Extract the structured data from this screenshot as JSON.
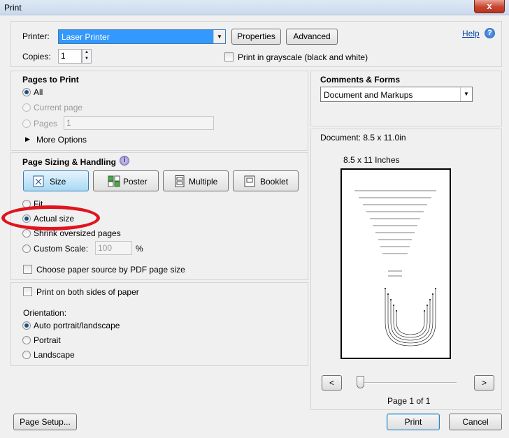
{
  "window": {
    "title": "Print",
    "close_glyph": "x"
  },
  "printer": {
    "label": "Printer:",
    "value": "Laser Printer",
    "properties_label": "Properties",
    "advanced_label": "Advanced",
    "help_label": "Help",
    "copies_label": "Copies:",
    "copies_value": "1",
    "grayscale_label": "Print in grayscale (black and white)"
  },
  "pages_to_print": {
    "heading": "Pages to Print",
    "all_label": "All",
    "current_label": "Current page",
    "pages_label": "Pages",
    "pages_value": "1",
    "more_options_label": "More Options"
  },
  "page_sizing": {
    "heading": "Page Sizing & Handling",
    "size_label": "Size",
    "poster_label": "Poster",
    "multiple_label": "Multiple",
    "booklet_label": "Booklet",
    "fit_label": "Fit",
    "actual_size_label": "Actual size",
    "shrink_label": "Shrink oversized pages",
    "custom_scale_label": "Custom Scale:",
    "custom_scale_value": "100",
    "percent_label": "%",
    "paper_source_label": "Choose paper source by PDF page size"
  },
  "duplex": {
    "both_sides_label": "Print on both sides of paper",
    "orientation_label": "Orientation:",
    "auto_label": "Auto portrait/landscape",
    "portrait_label": "Portrait",
    "landscape_label": "Landscape"
  },
  "comments_forms": {
    "heading": "Comments & Forms",
    "value": "Document and Markups"
  },
  "preview": {
    "document_size": "Document: 8.5 x 11.0in",
    "page_size_label": "8.5 x 11 Inches",
    "prev_label": "<",
    "next_label": ">",
    "page_status": "Page 1 of 1",
    "slider_position": 0
  },
  "footer": {
    "page_setup_label": "Page Setup...",
    "print_label": "Print",
    "cancel_label": "Cancel"
  }
}
